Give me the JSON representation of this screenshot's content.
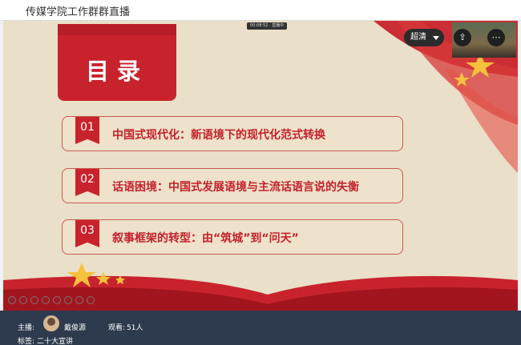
{
  "window": {
    "title": "传媒学院工作群群直播"
  },
  "slide": {
    "heading": "目录",
    "items": [
      {
        "num": "01",
        "text": "中国式现代化：新语境下的现代化范式转换"
      },
      {
        "num": "02",
        "text": "话语困境：中国式发展语境与主流话语言说的失衡"
      },
      {
        "num": "03",
        "text": "叙事框架的转型：由“筑城”到“问天”"
      }
    ],
    "top_chip": "00:08:52 · 直播中"
  },
  "controls": {
    "quality": "超清",
    "share_icon": "share-icon",
    "more_icon": "more-icon"
  },
  "footer": {
    "host_label": "主播:",
    "host_name": "戴俊源",
    "viewers_label": "观看:",
    "viewers_value": "51人",
    "tag_label": "标签:",
    "tag_value": "二十大宣讲"
  },
  "colors": {
    "red": "#c8232c",
    "cream": "#eadfc8",
    "footer": "#2e3b4e"
  }
}
